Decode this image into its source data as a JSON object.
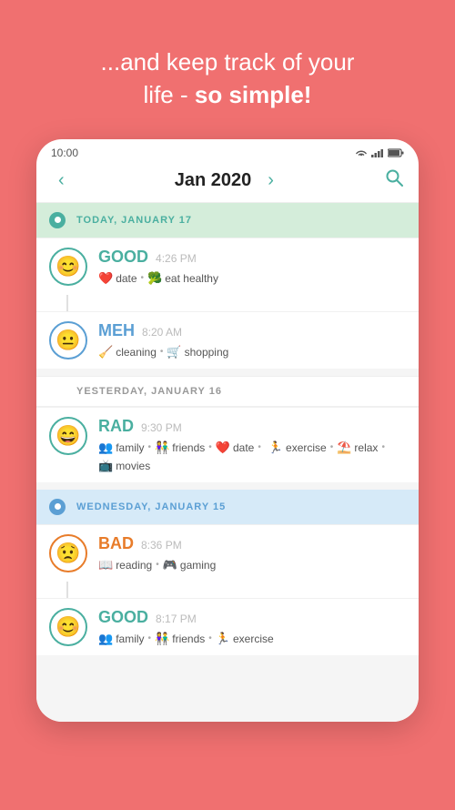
{
  "header": {
    "line1": "...and keep track of your",
    "line2_normal": "life - ",
    "line2_bold": "so simple!"
  },
  "statusBar": {
    "time": "10:00",
    "icons": [
      "wifi",
      "signal",
      "battery"
    ]
  },
  "navBar": {
    "prevLabel": "‹",
    "nextLabel": "›",
    "month": "Jan 2020",
    "searchIcon": "🔍"
  },
  "days": [
    {
      "id": "today",
      "type": "today",
      "label": "TODAY, JANUARY 17",
      "sublabel": null,
      "entries": [
        {
          "mood": "GOOD",
          "moodType": "good",
          "time": "4:26 PM",
          "emoji": "😊",
          "tags": [
            {
              "icon": "❤️",
              "label": "date"
            },
            {
              "icon": "🥦",
              "label": "eat healthy"
            }
          ]
        },
        {
          "mood": "MEH",
          "moodType": "meh",
          "time": "8:20 AM",
          "emoji": "😐",
          "tags": [
            {
              "icon": "🧹",
              "label": "cleaning"
            },
            {
              "icon": "🛒",
              "label": "shopping"
            }
          ]
        }
      ]
    },
    {
      "id": "yesterday",
      "type": "yesterday",
      "label": "YESTERDAY, JANUARY 16",
      "sublabel": null,
      "entries": [
        {
          "mood": "RAD",
          "moodType": "rad",
          "time": "9:30 PM",
          "emoji": "😄",
          "tags": [
            {
              "icon": "👥",
              "label": "family"
            },
            {
              "icon": "👫",
              "label": "friends"
            },
            {
              "icon": "❤️",
              "label": "date"
            },
            {
              "icon": "🏃",
              "label": "exercise"
            },
            {
              "icon": "⛱️",
              "label": "relax"
            },
            {
              "icon": "📺",
              "label": "movies"
            }
          ]
        }
      ]
    },
    {
      "id": "wednesday",
      "type": "wednesday",
      "label": "WEDNESDAY, JANUARY 15",
      "sublabel": null,
      "entries": [
        {
          "mood": "BAD",
          "moodType": "bad",
          "time": "8:36 PM",
          "emoji": "😟",
          "tags": [
            {
              "icon": "📖",
              "label": "reading"
            },
            {
              "icon": "🎮",
              "label": "gaming"
            }
          ]
        },
        {
          "mood": "GOOD",
          "moodType": "good",
          "time": "8:17 PM",
          "emoji": "😊",
          "tags": [
            {
              "icon": "👥",
              "label": "family"
            },
            {
              "icon": "👫",
              "label": "friends"
            },
            {
              "icon": "🏃",
              "label": "exercise"
            }
          ]
        }
      ]
    }
  ]
}
